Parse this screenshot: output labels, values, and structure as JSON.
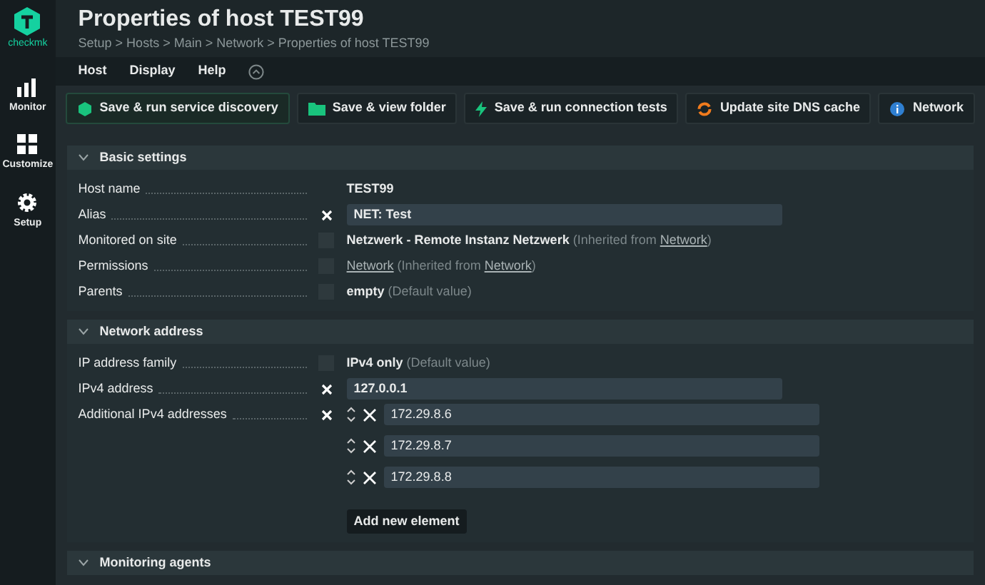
{
  "sidebar": {
    "logo_text": "checkmk",
    "items": [
      {
        "label": "Monitor",
        "kind": "monitor"
      },
      {
        "label": "Customize",
        "kind": "customize"
      },
      {
        "label": "Setup",
        "kind": "setup"
      }
    ]
  },
  "page": {
    "title": "Properties of host TEST99",
    "breadcrumb": "Setup > Hosts > Main > Network > Properties of host TEST99"
  },
  "menu": [
    "Host",
    "Display",
    "Help"
  ],
  "toolbar": [
    {
      "label": "Save & run service discovery",
      "kind": "discovery"
    },
    {
      "label": "Save & view folder",
      "kind": "folder"
    },
    {
      "label": "Save & run connection tests",
      "kind": "bolt"
    },
    {
      "label": "Update site DNS cache",
      "kind": "refresh"
    },
    {
      "label": "Network",
      "kind": "info"
    }
  ],
  "sections": [
    {
      "title": "Basic settings",
      "expanded": true,
      "rows": [
        {
          "label": "Host name",
          "value": {
            "kind": "text",
            "parts": [
              {
                "text": "TEST99",
                "kind": "value"
              }
            ]
          }
        },
        {
          "label": "Alias",
          "checked": true,
          "value": {
            "kind": "input",
            "text": "NET: Test"
          }
        },
        {
          "label": "Monitored on site",
          "checked": false,
          "value": {
            "kind": "text",
            "parts": [
              {
                "text": "Netzwerk - Remote Instanz Netzwerk",
                "kind": "value"
              },
              {
                "text": " (Inherited from ",
                "kind": "note"
              },
              {
                "text": "Network",
                "kind": "link"
              },
              {
                "text": ")",
                "kind": "note"
              }
            ]
          }
        },
        {
          "label": "Permissions",
          "checked": false,
          "value": {
            "kind": "text",
            "parts": [
              {
                "text": "Network",
                "kind": "link"
              },
              {
                "text": " (Inherited from ",
                "kind": "note"
              },
              {
                "text": "Network",
                "kind": "link"
              },
              {
                "text": ")",
                "kind": "note"
              }
            ]
          }
        },
        {
          "label": "Parents",
          "checked": false,
          "value": {
            "kind": "text",
            "parts": [
              {
                "text": "empty",
                "kind": "value"
              },
              {
                "text": " (Default value)",
                "kind": "note"
              }
            ]
          }
        }
      ]
    },
    {
      "title": "Network address",
      "expanded": true,
      "rows": [
        {
          "label": "IP address family",
          "checked": false,
          "value": {
            "kind": "text",
            "parts": [
              {
                "text": "IPv4 only",
                "kind": "value"
              },
              {
                "text": " (Default value)",
                "kind": "note"
              }
            ]
          }
        },
        {
          "label": "IPv4 address",
          "checked": true,
          "value": {
            "kind": "input",
            "text": "127.0.0.1"
          }
        },
        {
          "label": "Additional IPv4 addresses",
          "checked": true,
          "value": {
            "kind": "list",
            "entries": [
              "172.29.8.6",
              "172.29.8.7",
              "172.29.8.8"
            ],
            "add_label": "Add new element"
          }
        }
      ]
    },
    {
      "title": "Monitoring agents",
      "expanded": true
    }
  ]
}
